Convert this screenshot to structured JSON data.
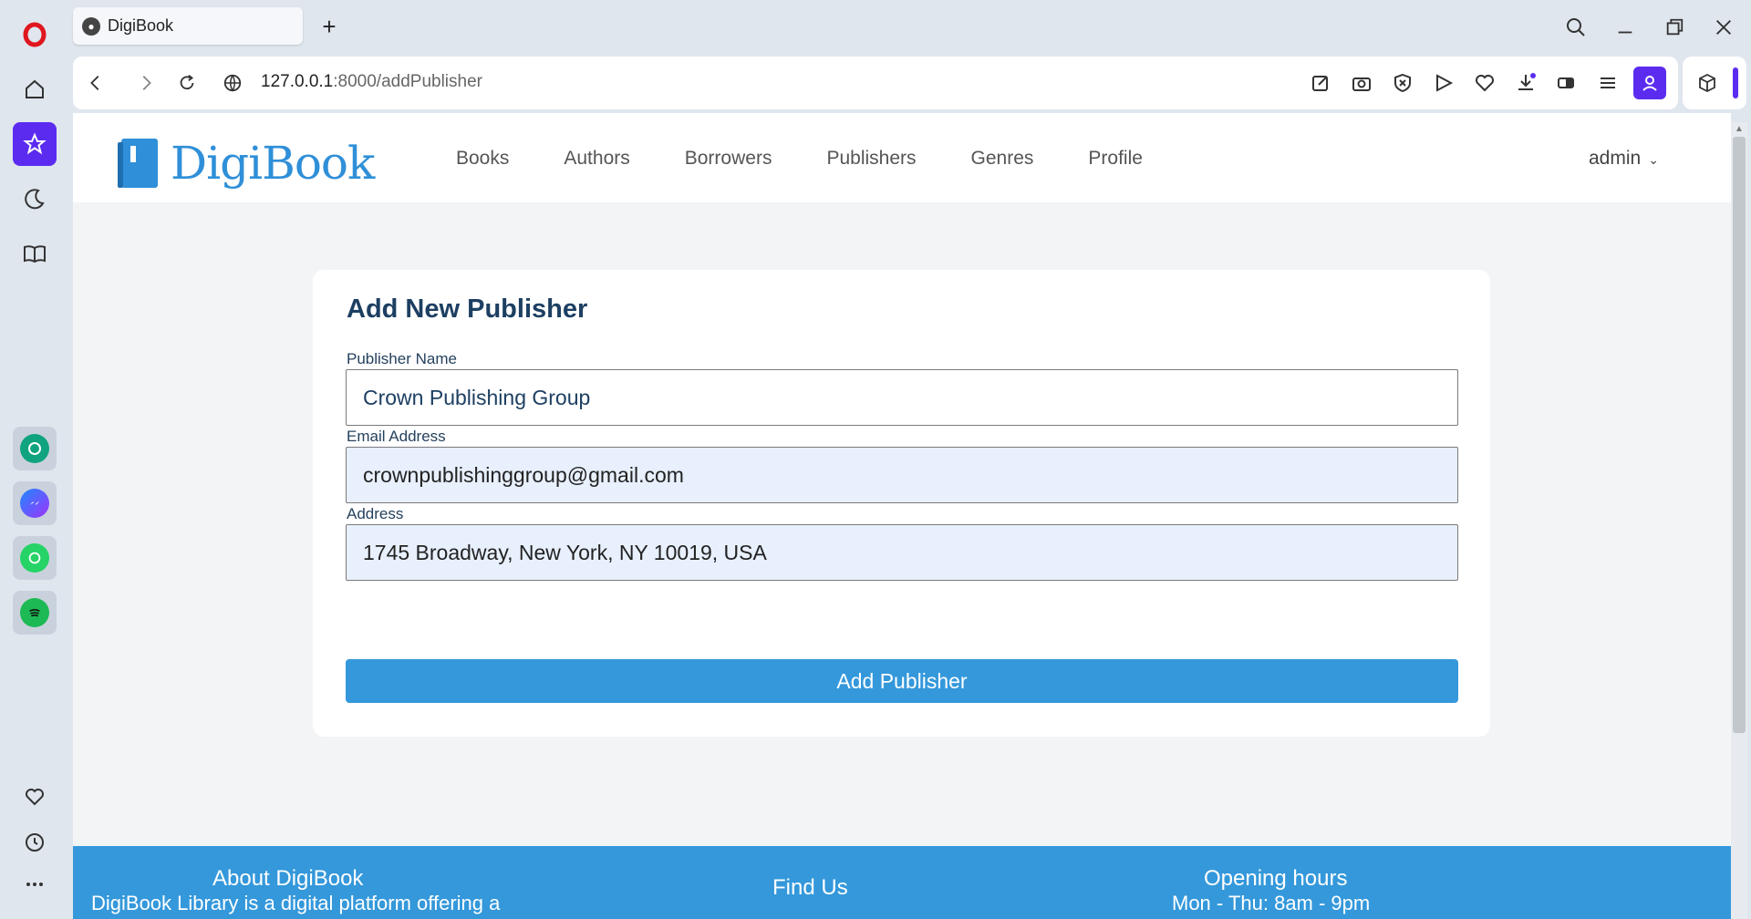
{
  "browser": {
    "tab_title": "DigiBook",
    "url_host": "127.0.0.1",
    "url_path": ":8000/addPublisher"
  },
  "nav": {
    "logo": "DigiBook",
    "items": [
      {
        "label": "Books"
      },
      {
        "label": "Authors"
      },
      {
        "label": "Borrowers"
      },
      {
        "label": "Publishers"
      },
      {
        "label": "Genres"
      },
      {
        "label": "Profile"
      }
    ],
    "user": "admin"
  },
  "form": {
    "title": "Add New Publisher",
    "name_label": "Publisher Name",
    "name_value": "Crown Publishing Group",
    "email_label": "Email Address",
    "email_value": "crownpublishinggroup@gmail.com",
    "address_label": "Address",
    "address_value": "1745 Broadway, New York, NY 10019, USA",
    "submit_label": "Add Publisher"
  },
  "footer": {
    "about_title": "About DigiBook",
    "about_text": "DigiBook Library is a digital platform offering a",
    "find_title": "Find Us",
    "hours_title": "Opening hours",
    "hours_text": "Mon - Thu: 8am - 9pm"
  },
  "colors": {
    "accent": "#3498db",
    "opera_active": "#5b2cf0",
    "heading": "#1d3f62"
  }
}
